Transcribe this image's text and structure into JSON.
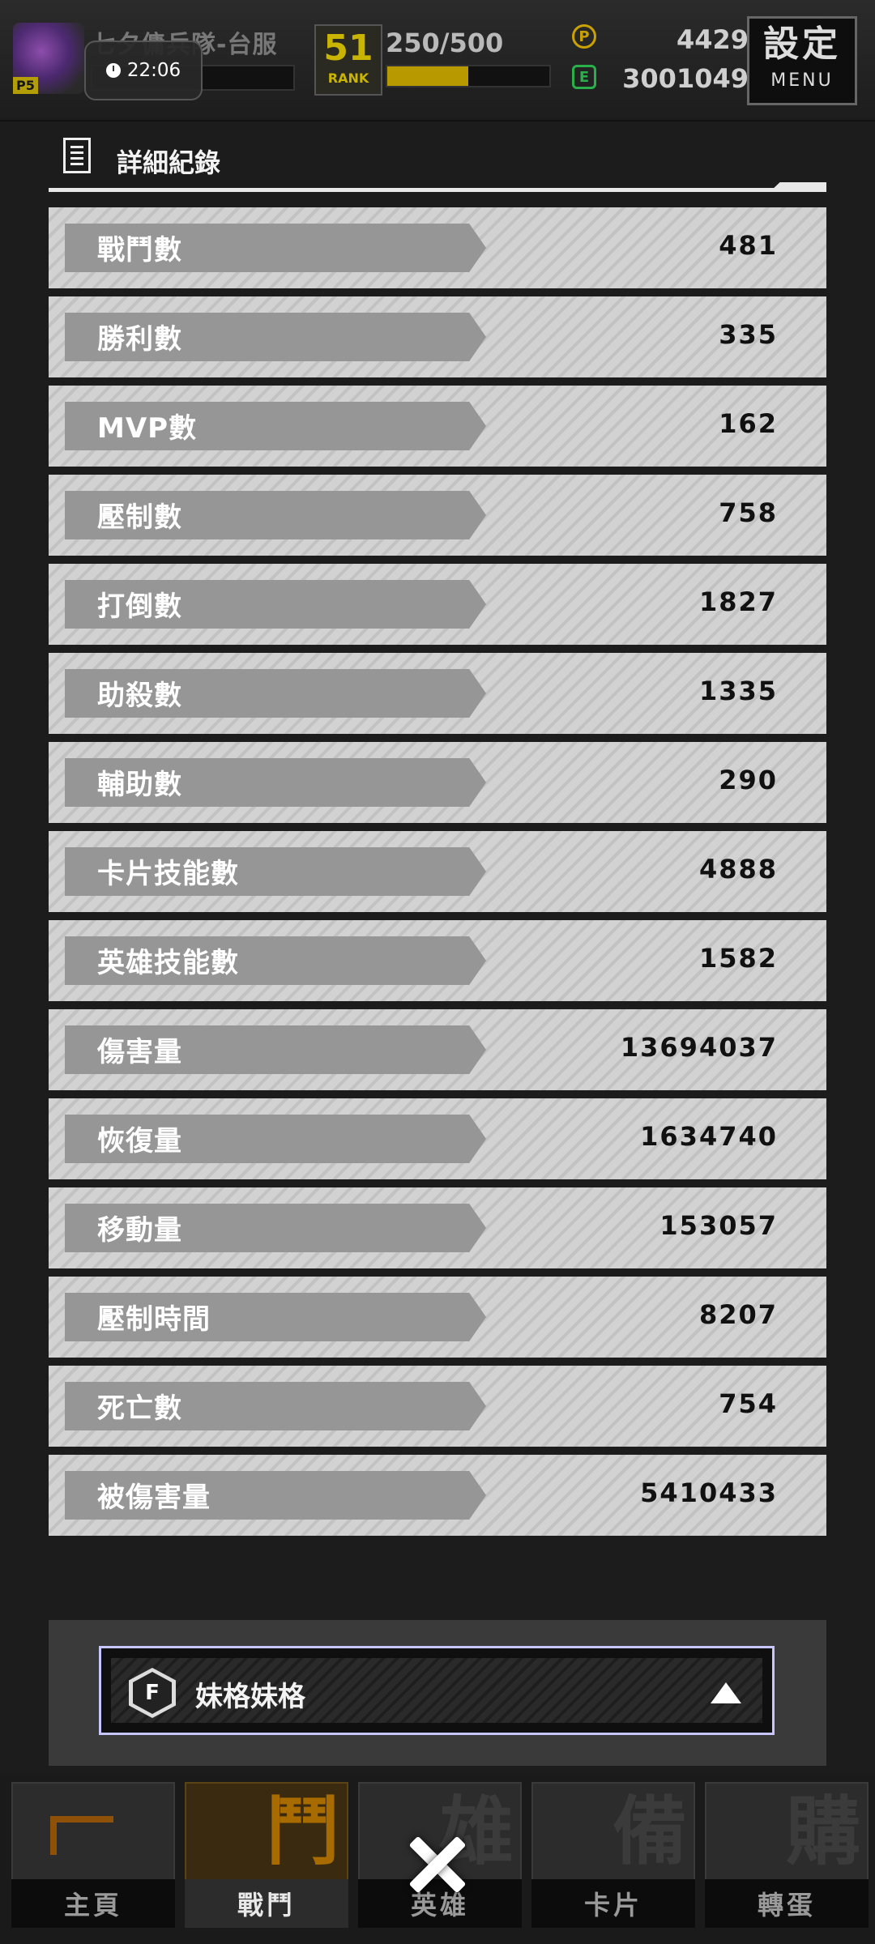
{
  "status_bar": {
    "time": "22:06"
  },
  "top_bar": {
    "avatar_level": "P5",
    "server_name": "七夕傭兵隊-台服",
    "rank_number": "51",
    "rank_label": "RANK",
    "stamina": "250/500",
    "stamina_fraction": 0.5,
    "coin_symbol": "P",
    "gem_symbol": "E",
    "coins": "4429",
    "gems": "3001049",
    "menu_big": "設定",
    "menu_small": "MENU"
  },
  "panel": {
    "title": "詳細紀錄",
    "rows": [
      {
        "label": "戰鬥數",
        "value": "481"
      },
      {
        "label": "勝利數",
        "value": "335"
      },
      {
        "label": "MVP數",
        "value": "162"
      },
      {
        "label": "壓制數",
        "value": "758"
      },
      {
        "label": "打倒數",
        "value": "1827"
      },
      {
        "label": "助殺數",
        "value": "1335"
      },
      {
        "label": "輔助數",
        "value": "290"
      },
      {
        "label": "卡片技能數",
        "value": "4888"
      },
      {
        "label": "英雄技能數",
        "value": "1582"
      },
      {
        "label": "傷害量",
        "value": "13694037"
      },
      {
        "label": "恢復量",
        "value": "1634740"
      },
      {
        "label": "移動量",
        "value": "153057"
      },
      {
        "label": "壓制時間",
        "value": "8207"
      },
      {
        "label": "死亡數",
        "value": "754"
      },
      {
        "label": "被傷害量",
        "value": "5410433"
      }
    ]
  },
  "selector": {
    "icon_letter": "F",
    "name": "妹格妹格"
  },
  "bottom_nav": {
    "items": [
      {
        "label": "主頁",
        "glyph": "",
        "active": false
      },
      {
        "label": "戰鬥",
        "glyph": "鬥",
        "active": true
      },
      {
        "label": "英雄",
        "glyph": "雄",
        "active": false
      },
      {
        "label": "卡片",
        "glyph": "備",
        "active": false
      },
      {
        "label": "轉蛋",
        "glyph": "購",
        "active": false
      }
    ]
  },
  "colors": {
    "row_bg": "#d2d2d2",
    "label_bg": "#969696",
    "selector_border": "#c8c6ff",
    "active_nav": "#a86b00"
  }
}
